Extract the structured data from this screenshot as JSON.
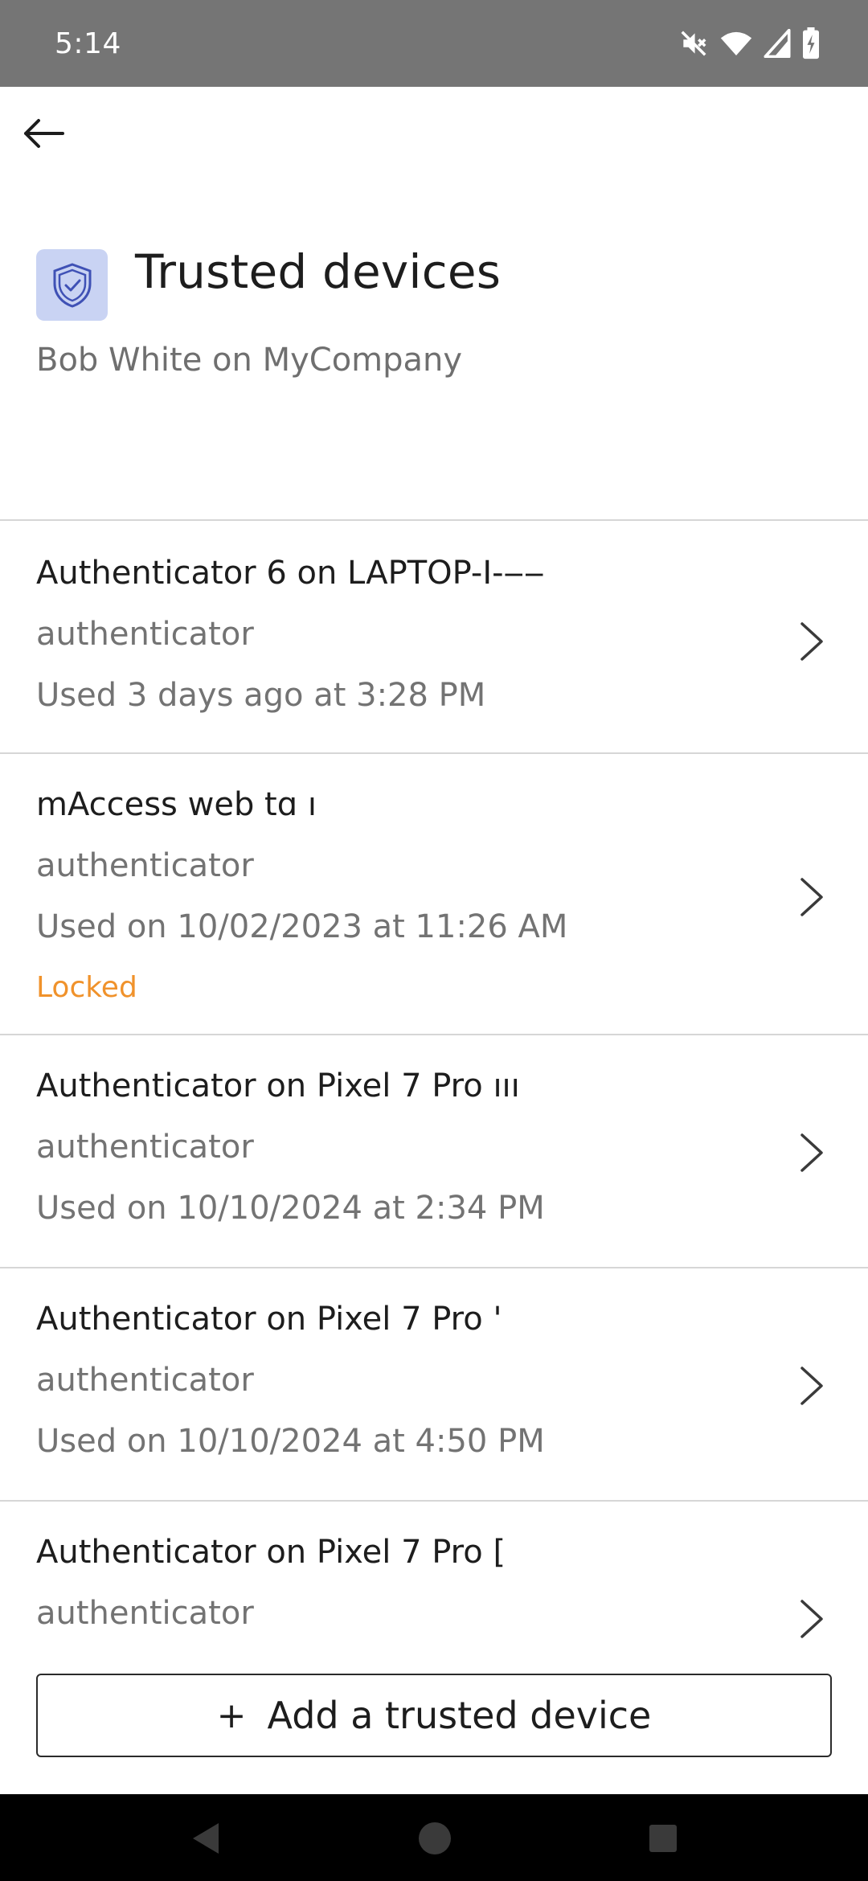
{
  "status_bar": {
    "time": "5:14",
    "icons": [
      "mute-icon",
      "wifi-icon",
      "signal-icon",
      "battery-icon"
    ]
  },
  "header": {
    "title": "Trusted devices",
    "subtitle": "Bob White on MyCompany",
    "icon": "shield-check-icon"
  },
  "devices": [
    {
      "name": "Authenticator 6 on LAPTOP-I-‒‒",
      "type": "authenticator",
      "used": "Used 3 days ago at 3:28 PM",
      "status": ""
    },
    {
      "name": "mAccess web tɑ ı",
      "type": "authenticator",
      "used": "Used on 10/02/2023 at 11:26 AM",
      "status": "Locked"
    },
    {
      "name": "Authenticator on Pixel 7 Pro ııı",
      "type": "authenticator",
      "used": "Used on 10/10/2024 at 2:34 PM",
      "status": ""
    },
    {
      "name": "Authenticator on Pixel 7 Pro '",
      "type": "authenticator",
      "used": "Used on 10/10/2024 at 4:50 PM",
      "status": ""
    },
    {
      "name": "Authenticator on Pixel 7 Pro [",
      "type": "authenticator",
      "used": "",
      "status": ""
    }
  ],
  "add_button": {
    "icon": "plus-icon",
    "label": "Add a trusted device"
  },
  "colors": {
    "status_bar": "#757575",
    "icon_tile": "#c9d3f3",
    "icon_stroke": "#3f51b5",
    "locked": "#f0922b"
  }
}
